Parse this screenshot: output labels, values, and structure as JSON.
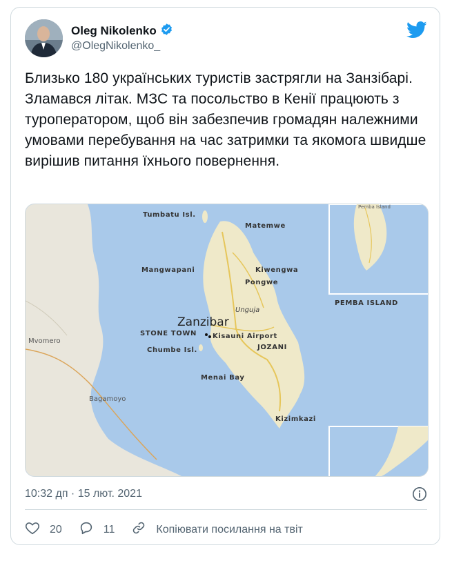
{
  "author": {
    "name": "Oleg Nikolenko",
    "handle": "@OlegNikolenko_",
    "verified": true
  },
  "tweet": {
    "text": "Близько 180 українських туристів застрягли на Занзібарі. Зламався літак. МЗС та посольство в Кенії працюють з туроператором, щоб він забезпечив громадян належними умовами перебування на час затримки та якомога швидше вирішив питання їхнього повернення.",
    "timestamp": "10:32 дп · 15 лют. 2021"
  },
  "map": {
    "labels": {
      "tumbatu": "Tumbatu Isl.",
      "matemwe": "Matemwe",
      "mangwapani": "Mangwapani",
      "kiwengwa": "Kiwengwa",
      "pongwe": "Pongwe",
      "pemba": "PEMBA ISLAND",
      "pemba_small": "Pemba Island",
      "unguja": "Unguja",
      "zanzibar": "Zanzibar",
      "stone_town": "STONE TOWN",
      "kisauni": "Kisauni Airport",
      "jozani": "JOZANI",
      "chumbe": "Chumbe Isl.",
      "mvomero": "Mvomero",
      "menai": "Menai Bay",
      "bagamoyo": "Bagamoyo",
      "kizimkazi": "Kizimkazi"
    },
    "colors": {
      "sea": "#a9c9ea",
      "land": "#e9e6dc",
      "island": "#efe9c9",
      "road": "#e6c65a"
    }
  },
  "actions": {
    "likes": "20",
    "replies": "11",
    "copy_link": "Копіювати посилання на твіт"
  },
  "colors": {
    "twitter_blue": "#1d9bf0",
    "secondary_text": "#536471"
  }
}
